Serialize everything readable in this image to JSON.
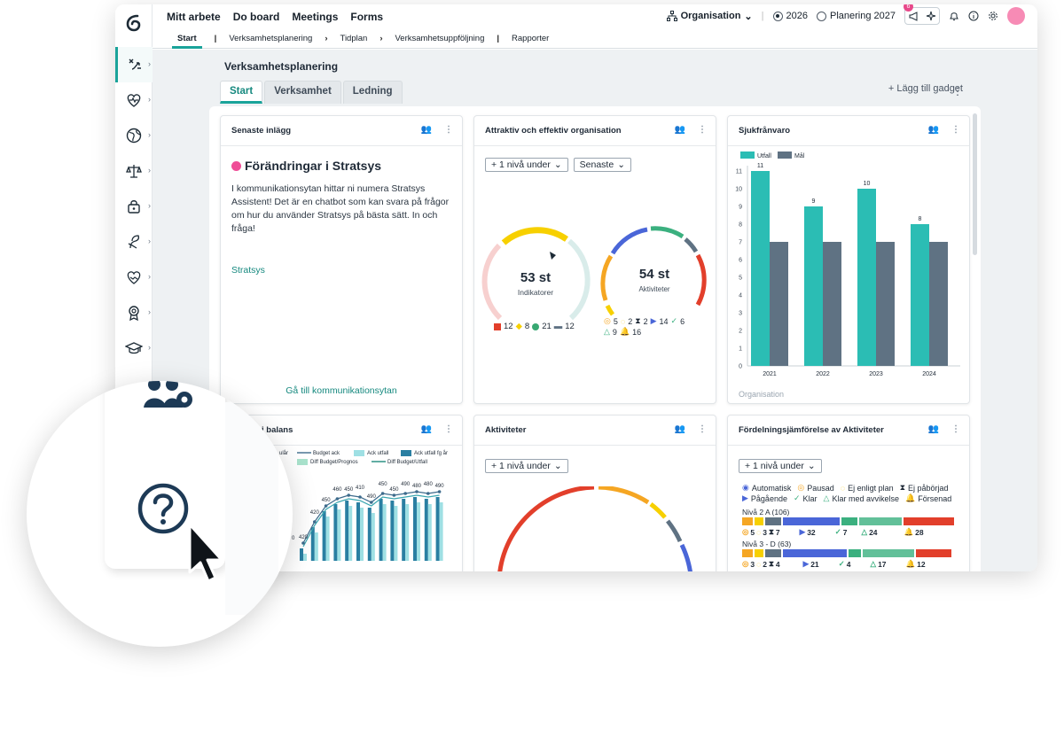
{
  "topnav": [
    "Mitt arbete",
    "Do board",
    "Meetings",
    "Forms"
  ],
  "topright": {
    "org": "Organisation",
    "year": "2026",
    "planning": "Planering 2027",
    "notif_count": "6"
  },
  "subnav": [
    "Start",
    "Verksamhetsplanering",
    "Tidplan",
    "Verksamhetsuppföljning",
    "Rapporter"
  ],
  "page": {
    "title": "Verksamhetsplanering",
    "tabs": [
      "Start",
      "Verksamhet",
      "Ledning"
    ],
    "add_gadget": "+ Lägg till gadget"
  },
  "posts": {
    "title": "Senaste inlägg",
    "post_title": "Förändringar i Stratsys",
    "post_body": "I kommunikationsytan hittar ni numera Stratsys Assistent! Det är en chatbot som kan svara på frågor om hur du använder Stratsys på bästa sätt. In och fråga!",
    "post_link": "Stratsys",
    "footer_link": "Gå till kommunikationsytan"
  },
  "org_card": {
    "title": "Attraktiv och effektiv organisation",
    "dropdown1": "+ 1 nivå under",
    "dropdown2": "Senaste",
    "gauge1": {
      "value": "53 st",
      "label": "Indikatorer",
      "legend": [
        "12",
        "8",
        "21",
        "12"
      ]
    },
    "gauge2": {
      "value": "54 st",
      "label": "Aktiviteter",
      "legend1": [
        "5",
        "2",
        "2",
        "14",
        "6"
      ],
      "legend2": [
        "9",
        "16"
      ]
    }
  },
  "sick_card": {
    "title": "Sjukfrånvaro",
    "footer": "Organisation",
    "colors": {
      "utfall": "#2bbdb4",
      "mal": "#5f7283"
    }
  },
  "chart_data": {
    "type": "bar",
    "title": "Sjukfrånvaro",
    "categories": [
      "2021",
      "2022",
      "2023",
      "2024"
    ],
    "series": [
      {
        "name": "Utfall",
        "values": [
          11,
          9,
          10,
          8
        ]
      },
      {
        "name": "Mål",
        "values": [
          7,
          7,
          7,
          7
        ]
      }
    ],
    "ylim": [
      0,
      11
    ],
    "yticks": [
      "0",
      "1",
      "2",
      "3",
      "4",
      "5",
      "6",
      "7",
      "8",
      "9",
      "10",
      "11"
    ],
    "xlabel": "Organisation",
    "legend": "top-left"
  },
  "balance_card": {
    "title": "i balans",
    "legend": [
      "Budget ack",
      "Ack utfall",
      "Ack utfall fg år",
      "Diff Budget/Prognos",
      "Diff Budget/Utfall"
    ],
    "legend_prefix": "ulår",
    "labels": [
      "420",
      "420",
      "450",
      "460",
      "450",
      "410",
      "490",
      "450",
      "450",
      "490",
      "480",
      "480",
      "490"
    ],
    "first_label": "0"
  },
  "activities_card": {
    "title": "Aktiviteter",
    "dropdown": "+ 1 nivå under"
  },
  "compare_card": {
    "title": "Fördelningsjämförelse av Aktiviteter",
    "dropdown": "+ 1 nivå under",
    "legend1": [
      "Automatisk",
      "Pausad",
      "Ej enligt plan",
      "Ej påbörjad"
    ],
    "legend2": [
      "Pågående",
      "Klar",
      "Klar med avvikelse",
      "Försenad"
    ],
    "level1": {
      "name": "Nivå 2 A (106)",
      "counts": [
        "5",
        "3",
        "7",
        "32",
        "7",
        "24",
        "28"
      ]
    },
    "level2": {
      "name": "Nivå 3 - D (63)",
      "counts": [
        "3",
        "2",
        "4",
        "21",
        "4",
        "17",
        "12"
      ]
    }
  }
}
